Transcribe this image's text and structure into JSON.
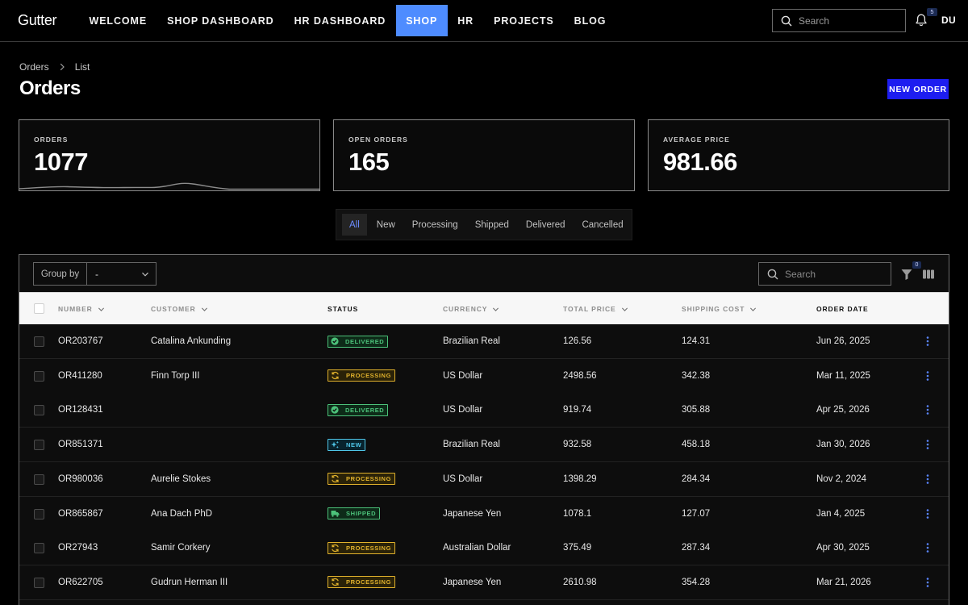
{
  "app": {
    "brand": "Gutter",
    "nav": [
      {
        "label": "WELCOME",
        "active": false
      },
      {
        "label": "SHOP DASHBOARD",
        "active": false
      },
      {
        "label": "HR DASHBOARD",
        "active": false
      },
      {
        "label": "SHOP",
        "active": true
      },
      {
        "label": "HR",
        "active": false
      },
      {
        "label": "PROJECTS",
        "active": false
      },
      {
        "label": "BLOG",
        "active": false
      }
    ],
    "search_placeholder": "Search",
    "notification_count": "5",
    "user_initials": "DU"
  },
  "breadcrumb": [
    "Orders",
    "List"
  ],
  "page_title": "Orders",
  "new_order_label": "NEW ORDER",
  "stats": [
    {
      "label": "ORDERS",
      "value": "1077"
    },
    {
      "label": "OPEN ORDERS",
      "value": "165"
    },
    {
      "label": "AVERAGE PRICE",
      "value": "981.66"
    }
  ],
  "tabs": [
    {
      "label": "All",
      "active": true
    },
    {
      "label": "New",
      "active": false
    },
    {
      "label": "Processing",
      "active": false
    },
    {
      "label": "Shipped",
      "active": false
    },
    {
      "label": "Delivered",
      "active": false
    },
    {
      "label": "Cancelled",
      "active": false
    }
  ],
  "toolbar": {
    "group_by_label": "Group by",
    "group_by_value": "-",
    "search_placeholder": "Search",
    "filter_count": "0"
  },
  "columns": [
    {
      "label": "NUMBER",
      "sortable": true
    },
    {
      "label": "CUSTOMER",
      "sortable": true
    },
    {
      "label": "STATUS",
      "sortable": false
    },
    {
      "label": "CURRENCY",
      "sortable": true
    },
    {
      "label": "TOTAL PRICE",
      "sortable": true
    },
    {
      "label": "SHIPPING COST",
      "sortable": true
    },
    {
      "label": "ORDER DATE",
      "sortable": false
    }
  ],
  "status_styles": {
    "DELIVERED": {
      "color": "#4cc27a",
      "bg": "#0d2a18",
      "icon": "check-circle-icon"
    },
    "PROCESSING": {
      "color": "#e0b12c",
      "bg": "#2a2208",
      "icon": "refresh-icon"
    },
    "NEW": {
      "color": "#4fc6e8",
      "bg": "#08232d",
      "icon": "sparkles-icon"
    },
    "SHIPPED": {
      "color": "#4cc27a",
      "bg": "#0d2a18",
      "icon": "truck-icon"
    }
  },
  "rows": [
    {
      "number": "OR203767",
      "customer": "Catalina Ankunding",
      "status": "DELIVERED",
      "currency": "Brazilian Real",
      "total": "126.56",
      "shipping": "124.31",
      "date": "Jun 26, 2025"
    },
    {
      "number": "OR411280",
      "customer": "Finn Torp III",
      "status": "PROCESSING",
      "currency": "US Dollar",
      "total": "2498.56",
      "shipping": "342.38",
      "date": "Mar 11, 2025"
    },
    {
      "number": "OR128431",
      "customer": "",
      "status": "DELIVERED",
      "currency": "US Dollar",
      "total": "919.74",
      "shipping": "305.88",
      "date": "Apr 25, 2026"
    },
    {
      "number": "OR851371",
      "customer": "",
      "status": "NEW",
      "currency": "Brazilian Real",
      "total": "932.58",
      "shipping": "458.18",
      "date": "Jan 30, 2026"
    },
    {
      "number": "OR980036",
      "customer": "Aurelie Stokes",
      "status": "PROCESSING",
      "currency": "US Dollar",
      "total": "1398.29",
      "shipping": "284.34",
      "date": "Nov 2, 2024"
    },
    {
      "number": "OR865867",
      "customer": "Ana Dach PhD",
      "status": "SHIPPED",
      "currency": "Japanese Yen",
      "total": "1078.1",
      "shipping": "127.07",
      "date": "Jan 4, 2025"
    },
    {
      "number": "OR27943",
      "customer": "Samir Corkery",
      "status": "PROCESSING",
      "currency": "Australian Dollar",
      "total": "375.49",
      "shipping": "287.34",
      "date": "Apr 30, 2025"
    },
    {
      "number": "OR622705",
      "customer": "Gudrun Herman III",
      "status": "PROCESSING",
      "currency": "Japanese Yen",
      "total": "2610.98",
      "shipping": "354.28",
      "date": "Mar 21, 2026"
    }
  ]
}
